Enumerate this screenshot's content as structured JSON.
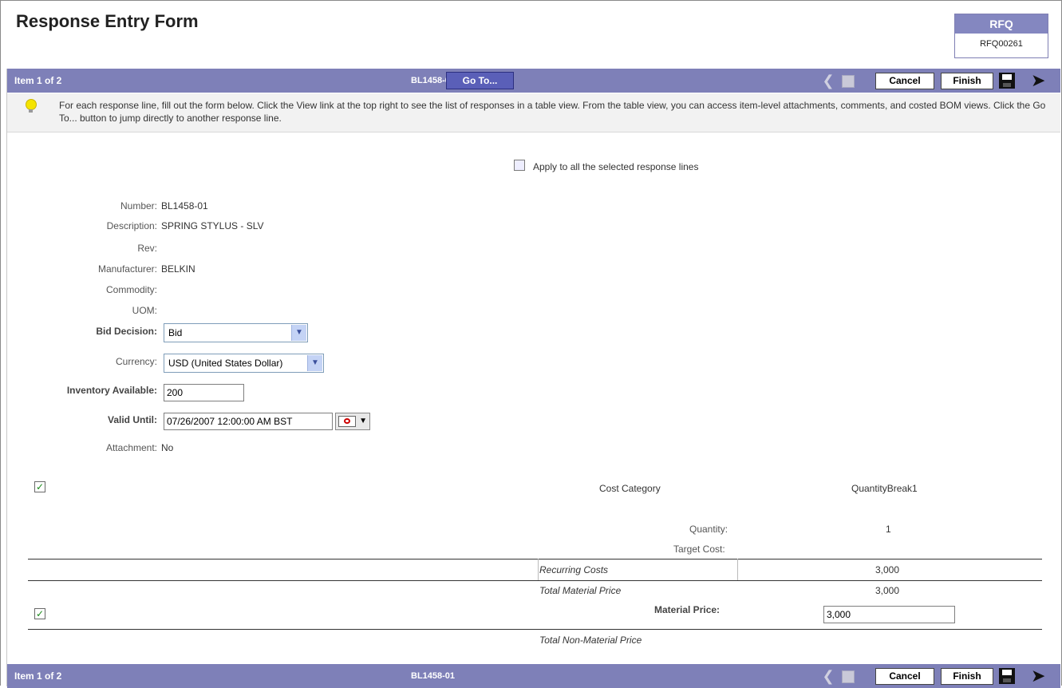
{
  "page": {
    "title": "Response Entry Form"
  },
  "rfq": {
    "label": "RFQ",
    "number": "RFQ00261"
  },
  "toolbar": {
    "item_counter": "Item 1 of 2",
    "item_number": "BL1458-01",
    "goto_label": "Go To...",
    "cancel_label": "Cancel",
    "finish_label": "Finish",
    "icons": {
      "back": "back-arrow-icon",
      "save": "save-icon",
      "next": "next-arrow-icon"
    }
  },
  "tip": {
    "icon": "lightbulb-icon",
    "text": "For each response line, fill out the form below. Click the View link at the top right to see the list of responses in a table view. From the table view, you can access item-level attachments, comments, and costed BOM views. Click the Go To... button to jump directly to another response line."
  },
  "apply_all": {
    "label": "Apply to all the selected response lines",
    "checked": false
  },
  "details": {
    "number": {
      "label": "Number:",
      "value": "BL1458-01"
    },
    "description": {
      "label": "Description:",
      "value": "SPRING STYLUS - SLV"
    },
    "rev": {
      "label": "Rev:",
      "value": ""
    },
    "manufacturer": {
      "label": "Manufacturer:",
      "value": "BELKIN"
    },
    "commodity": {
      "label": "Commodity:",
      "value": ""
    },
    "uom": {
      "label": "UOM:",
      "value": ""
    },
    "bid_decision": {
      "label": "Bid Decision:",
      "value": "Bid"
    },
    "currency": {
      "label": "Currency:",
      "value": "USD (United States Dollar)"
    },
    "inventory": {
      "label": "Inventory Available:",
      "value": "200"
    },
    "valid_until": {
      "label": "Valid Until:",
      "value": "07/26/2007 12:00:00 AM BST"
    },
    "attachment": {
      "label": "Attachment:",
      "value": "No"
    }
  },
  "cost": {
    "header_category": "Cost Category",
    "header_break": "QuantityBreak1",
    "quantity_label": "Quantity:",
    "quantity_value": "1",
    "target_label": "Target Cost:",
    "target_value": "",
    "recurring_label": "Recurring Costs",
    "recurring_value": "3,000",
    "total_material_label": "Total Material Price",
    "total_material_value": "3,000",
    "material_price_label": "Material Price:",
    "material_price_value": "3,000",
    "total_nonmaterial_label": "Total Non-Material Price"
  },
  "colors": {
    "bar": "#7e80b8",
    "goto": "#5a5fb8",
    "rfq_header": "#8487c0"
  }
}
